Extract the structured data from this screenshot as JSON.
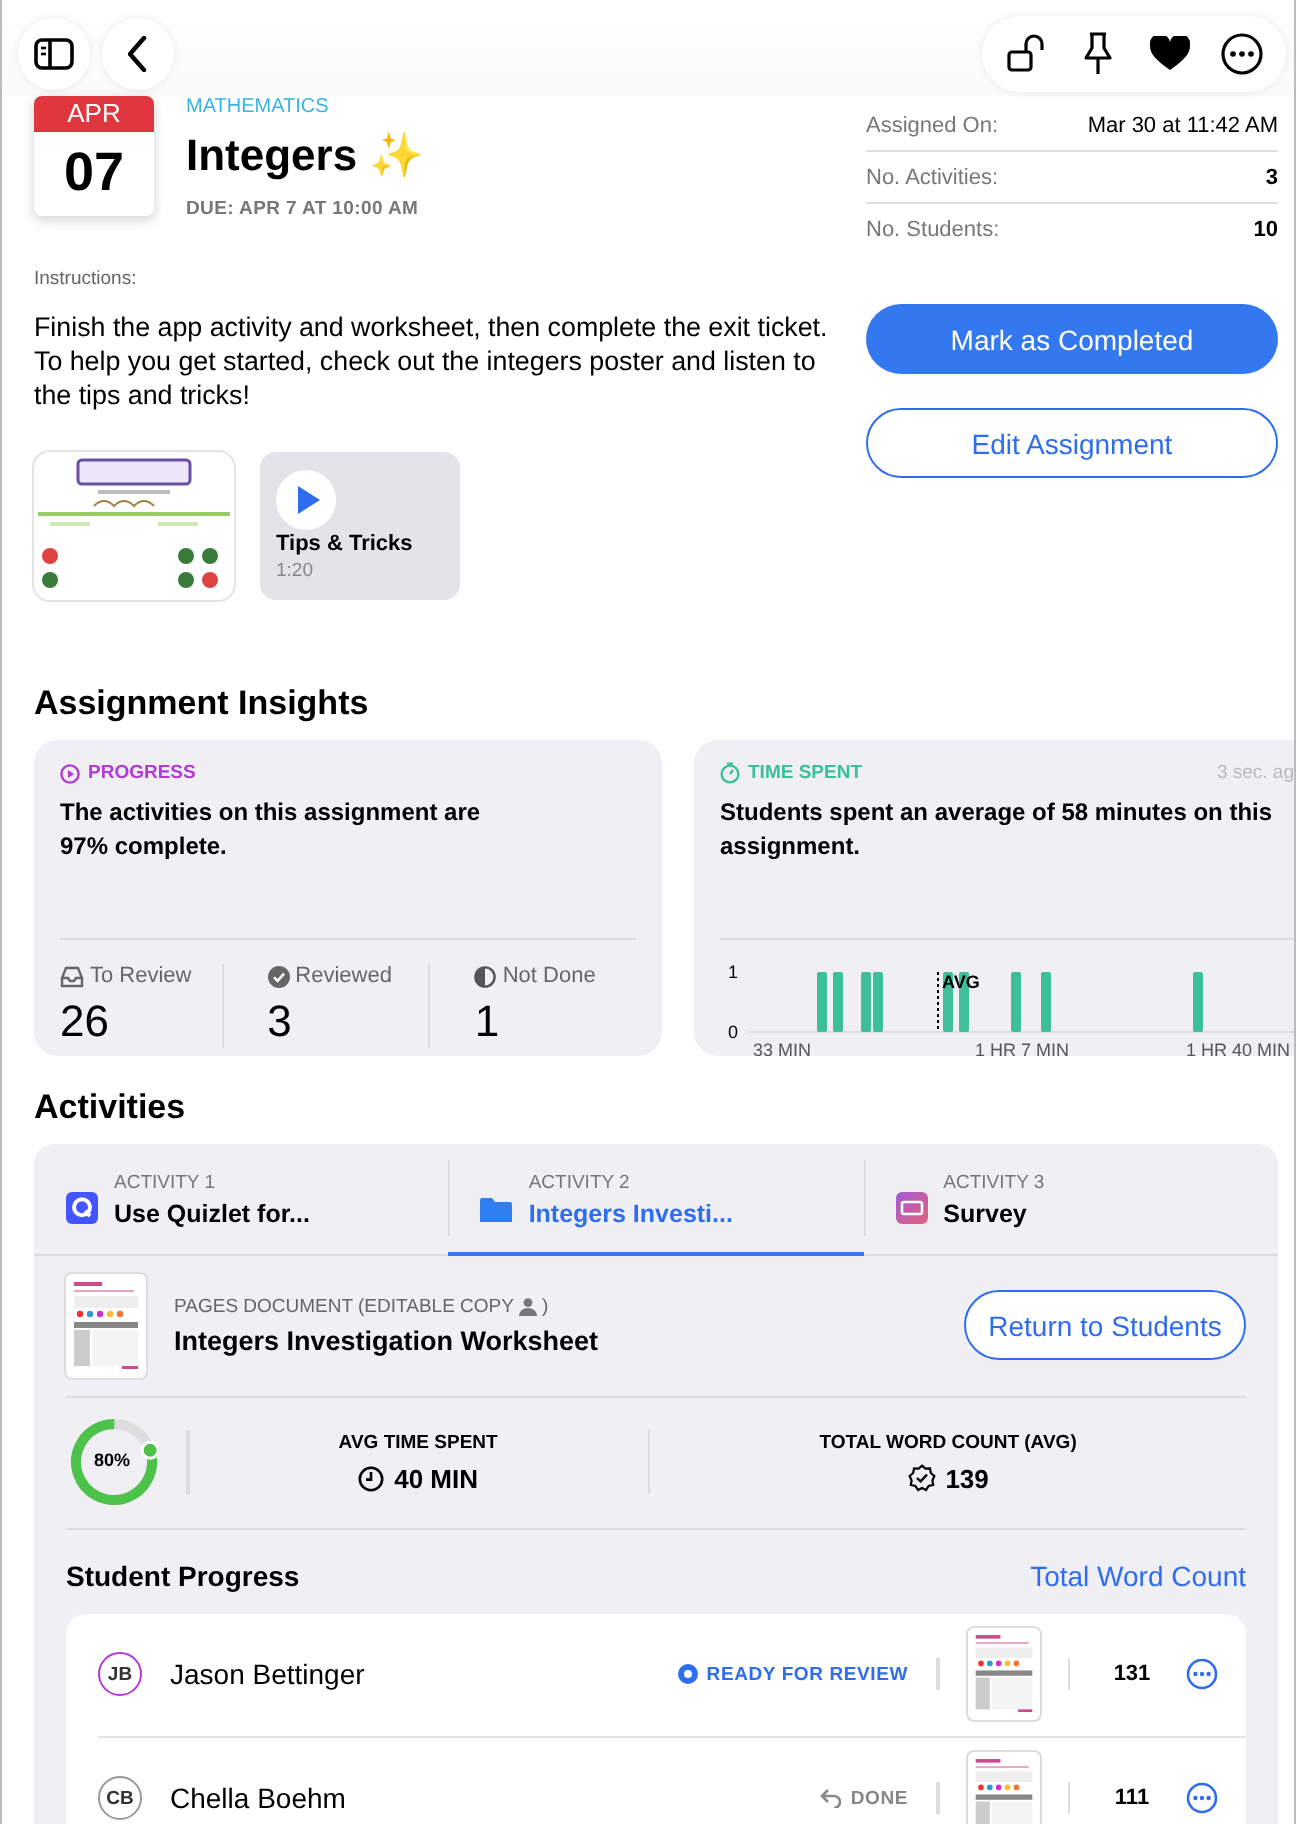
{
  "assignment": {
    "month": "APR",
    "day": "07",
    "subject": "MATHEMATICS",
    "title": "Integers ✨",
    "due": "DUE: APR 7 AT 10:00 AM",
    "instructions_label": "Instructions:",
    "instructions": "Finish the app activity and worksheet, then complete the exit ticket. To help you get started, check out the integers poster and listen to the tips and tricks!",
    "attachments": [
      {
        "kind": "picture"
      },
      {
        "kind": "audio",
        "title": "Tips & Tricks",
        "duration": "1:20"
      }
    ]
  },
  "details": [
    {
      "label": "Assigned On:",
      "value": "Mar 30 at 11:42 AM"
    },
    {
      "label": "No. Activities:",
      "value": "3"
    },
    {
      "label": "No. Students:",
      "value": "10"
    }
  ],
  "actions": [
    {
      "label": "Mark as Completed",
      "kind": "primary"
    },
    {
      "label": "Edit Assignment",
      "kind": "outline"
    }
  ],
  "insights": {
    "heading": "Assignment Insights",
    "progress": {
      "label": "PROGRESS",
      "summary": "The activities on this assignment are 97% complete.",
      "stats": [
        {
          "label": "To Review",
          "value": "26"
        },
        {
          "label": "Reviewed",
          "value": "3"
        },
        {
          "label": "Not Done",
          "value": "1"
        }
      ]
    },
    "time_spent": {
      "label": "TIME SPENT",
      "updated": "3 sec. ag",
      "summary": "Students spent an average of 58 minutes on this assignment.",
      "y_labels": [
        "1",
        "0"
      ],
      "x_labels": [
        "33 MIN",
        "1 HR 7 MIN",
        "1 HR 40 MIN"
      ],
      "average_label": "AVG"
    }
  },
  "activities": {
    "heading": "Activities",
    "tabs": [
      {
        "number": "ACTIVITY 1",
        "title": "Use Quizlet for...",
        "selected": false
      },
      {
        "number": "ACTIVITY 2",
        "title": "Integers Investi...",
        "selected": true
      },
      {
        "number": "ACTIVITY 3",
        "title": "Survey",
        "selected": false
      }
    ],
    "document": {
      "type": "PAGES DOCUMENT (EDITABLE COPY",
      "type_end": ")",
      "title": "Integers Investigation Worksheet",
      "button": "Return to Students"
    },
    "completion": {
      "label": "80%",
      "level": 0.8
    },
    "avg_time": {
      "label": "AVG TIME SPENT",
      "value": "40 MIN"
    },
    "word_count": {
      "label": "TOTAL WORD COUNT (AVG)",
      "value": "139"
    },
    "student_progress": {
      "heading": "Student Progress",
      "sort_link": "Total Word Count",
      "students": [
        {
          "initials": "JB",
          "name": "Jason Bettinger",
          "kind": "ready",
          "status": "READY FOR REVIEW",
          "word_count": "131"
        },
        {
          "initials": "CB",
          "name": "Chella Boehm",
          "kind": "done",
          "status": "DONE",
          "word_count": "111"
        }
      ]
    }
  }
}
